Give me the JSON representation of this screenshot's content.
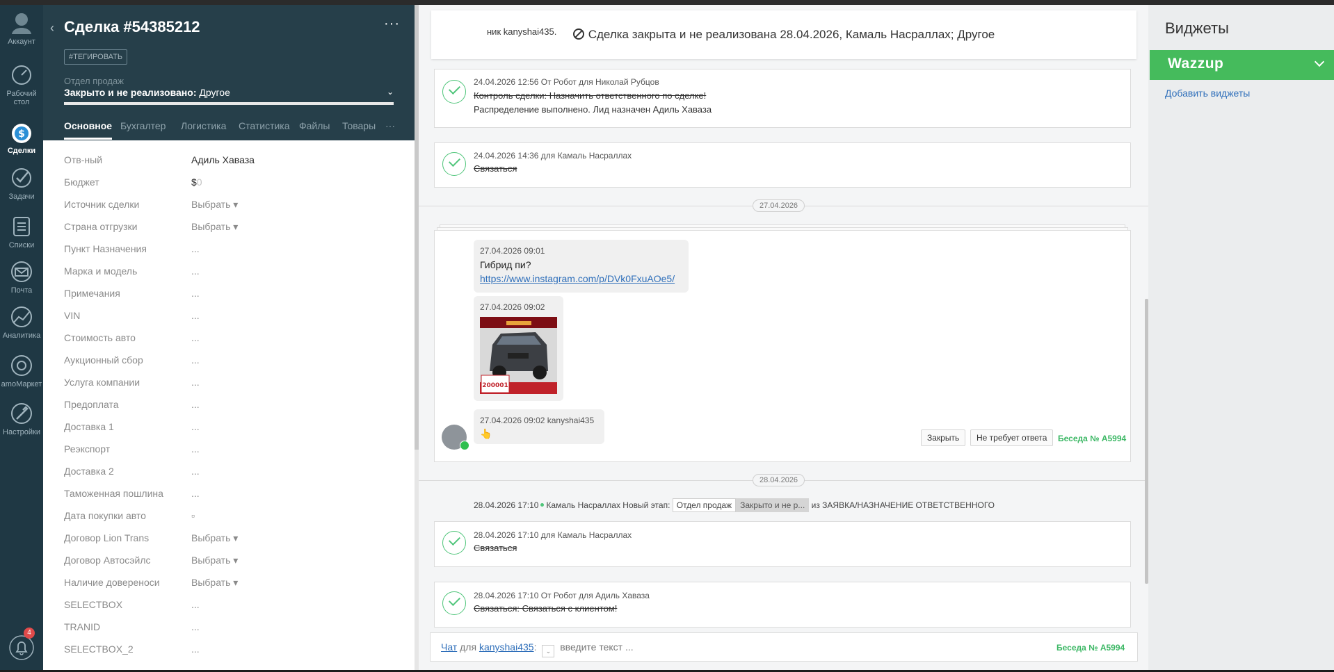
{
  "nav": {
    "items": [
      {
        "label": "Аккаунт"
      },
      {
        "label": "Рабочий стол"
      },
      {
        "label": "Сделки"
      },
      {
        "label": "Задачи"
      },
      {
        "label": "Списки"
      },
      {
        "label": "Почта"
      },
      {
        "label": "Аналитика"
      },
      {
        "label": "amoМаркет"
      },
      {
        "label": "Настройки"
      }
    ],
    "notification_count": "4"
  },
  "deal": {
    "title": "Сделка #54385212",
    "tag_button": "#ТЕГИРОВАТЬ",
    "pipeline": "Отдел продаж",
    "stage_bold": "Закрыто и не реализовано:",
    "stage_rest": " Другое",
    "tabs": [
      "Основное",
      "Бухгалтер",
      "Логистика",
      "Статистика",
      "Файлы",
      "Товары"
    ],
    "fields": [
      {
        "label": "Отв-ный",
        "value": "Адиль Хаваза"
      },
      {
        "label": "Бюджет",
        "value": "$",
        "value_extra": "0"
      },
      {
        "label": "Источник сделки",
        "value": "Выбрать ▾"
      },
      {
        "label": "Страна отгрузки",
        "value": "Выбрать ▾"
      },
      {
        "label": "Пункт Назначения",
        "value": "..."
      },
      {
        "label": "Марка и модель",
        "value": "..."
      },
      {
        "label": "Примечания",
        "value": "..."
      },
      {
        "label": "VIN",
        "value": "..."
      },
      {
        "label": "Стоимость авто",
        "value": "..."
      },
      {
        "label": "Аукционный сбор",
        "value": "..."
      },
      {
        "label": "Услуга компании",
        "value": "..."
      },
      {
        "label": "Предоплата",
        "value": "..."
      },
      {
        "label": "Доставка 1",
        "value": "..."
      },
      {
        "label": "Реэкспорт",
        "value": "..."
      },
      {
        "label": "Доставка 2",
        "value": "..."
      },
      {
        "label": "Таможенная пошлина",
        "value": "..."
      },
      {
        "label": "Дата покупки авто",
        "value": "▫"
      },
      {
        "label": "Договор Lion Trans",
        "value": "Выбрать ▾"
      },
      {
        "label": "Договор Автосэйлс",
        "value": "Выбрать ▾"
      },
      {
        "label": "Наличие довереноси",
        "value": "Выбрать ▾"
      },
      {
        "label": "SELECTBOX",
        "value": "..."
      },
      {
        "label": "TRANID",
        "value": "..."
      },
      {
        "label": "SELECTBOX_2",
        "value": "..."
      }
    ]
  },
  "feed": {
    "overflow_text": "ник kanyshai435.",
    "closed_banner": "Сделка закрыта и не реализована 28.04.2026, Камаль Насраллах; Другое",
    "task1": {
      "meta": "24.04.2026 12:56  От Робот для Николай Рубцов",
      "line1": "Контроль сделки: Назначить ответственного по сделке!",
      "line2": "Распределение выполнено. Лид назначен Адиль Хаваза"
    },
    "task2": {
      "meta": "24.04.2026 14:36  для Камаль Насраллах",
      "text": "Связаться"
    },
    "date1": "27.04.2026",
    "msg1": {
      "meta": "27.04.2026 09:01",
      "text": "Гибрид пи?",
      "link": "https://www.instagram.com/p/DVk0FxuAOe5/"
    },
    "msg2": {
      "meta": "27.04.2026 09:02",
      "image_badge": "200001"
    },
    "msg3": {
      "meta": "27.04.2026 09:02 kanyshai435",
      "emoji": "👆"
    },
    "close_button": "Закрыть",
    "no_reply_button": "Не требует ответа",
    "conversation_label": "Беседа № A5994",
    "date2": "28.04.2026",
    "event": {
      "time": "28.04.2026 17:10",
      "text": "Камаль Насраллах Новый этап:",
      "chip1": "Отдел продаж",
      "chip2": "Закрыто и не р...",
      "from": "из ЗАЯВКА/НАЗНАЧЕНИЕ ОТВЕТСТВЕННОГО"
    },
    "task3": {
      "meta": "28.04.2026 17:10  для Камаль Насраллах",
      "text": "Связаться"
    },
    "task4": {
      "meta": "28.04.2026 17:10  От Робот для Адиль Хаваза",
      "text": "Связаться: Связаться с клиентом!"
    },
    "chat": {
      "chat_link": "Чат",
      "for_word": "для",
      "user_link": "kanyshai435",
      "colon": ":",
      "placeholder": "введите текст ...",
      "conversation": "Беседа № A5994"
    }
  },
  "widgets": {
    "title": "Виджеты",
    "wazzup": "Wazzup",
    "add_link": "Добавить виджеты"
  },
  "colors": {
    "nav_bg": "#1f3844",
    "deal_header_bg": "#263f4a",
    "accent_green": "#45bb5c",
    "link_blue": "#2f6fba"
  }
}
